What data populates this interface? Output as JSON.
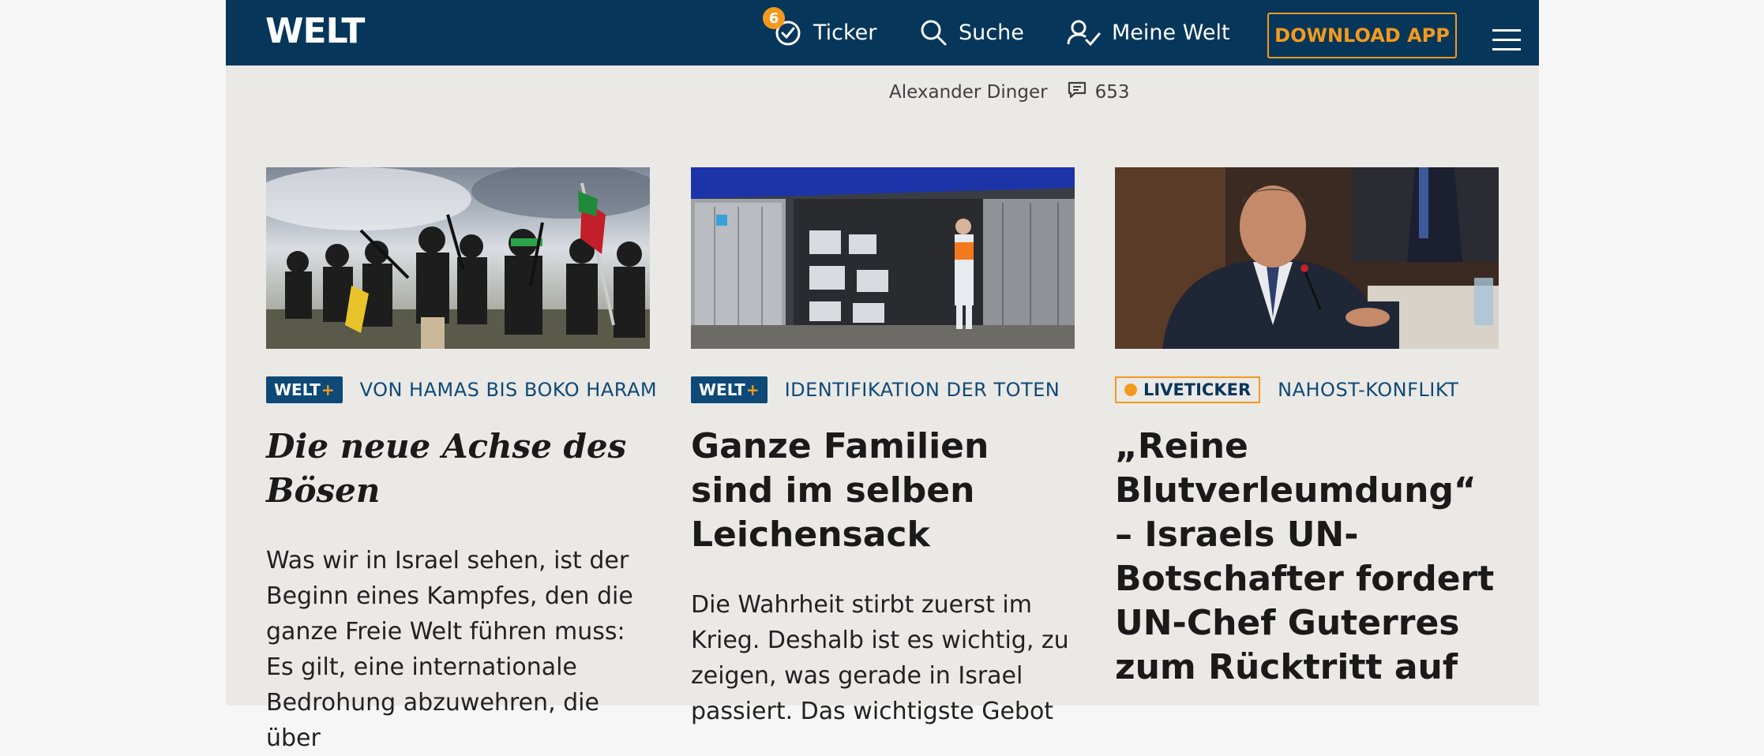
{
  "header": {
    "logo": "WELT",
    "ticker": {
      "label": "Ticker",
      "badge_count": "6",
      "icon": "clock-check-icon"
    },
    "search": {
      "label": "Suche",
      "icon": "search-icon"
    },
    "account": {
      "label": "Meine Welt",
      "icon": "user-check-icon"
    },
    "download_label": "DOWNLOAD APP",
    "menu_icon": "hamburger-menu-icon"
  },
  "prev_article": {
    "author": "Alexander Dinger",
    "comment_count": "653",
    "comment_icon": "comment-icon"
  },
  "articles": [
    {
      "badge": "WELT+",
      "badge_text": "WELT",
      "badge_plus": "+",
      "kicker": "VON HAMAS BIS BOKO HARAM",
      "headline": "Die neue Achse des Bösen",
      "teaser": "Was wir in Israel sehen, ist der Beginn eines Kampfes, den die ganze Freie Welt führen muss: Es gilt, eine internationale Bedrohung abzuwehren, die über"
    },
    {
      "badge": "WELT+",
      "badge_text": "WELT",
      "badge_plus": "+",
      "kicker": "IDENTIFIKATION DER TOTEN",
      "headline": "Ganze Familien sind im selben Leichensack",
      "teaser": "Die Wahrheit stirbt zuerst im Krieg. Deshalb ist es wichtig, zu zeigen, was gerade in Israel passiert. Das wichtigste Gebot"
    },
    {
      "badge": "LIVETICKER",
      "kicker": "NAHOST-KONFLIKT",
      "headline": "„Reine Blutverleumdung“ – Israels UN-Botschafter fordert UN-Chef Guterres zum Rücktritt auf"
    }
  ],
  "colors": {
    "header_bg": "#06365a",
    "accent_orange": "#f39a1e",
    "kicker_blue": "#0e4978",
    "page_bg": "#ebe9e5"
  }
}
